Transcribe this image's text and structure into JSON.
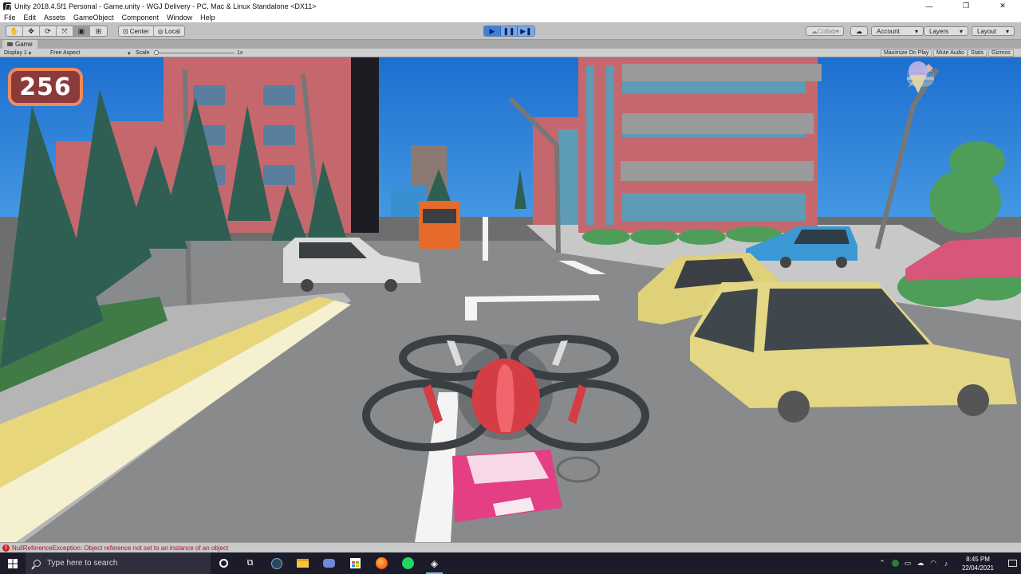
{
  "window": {
    "title": "Unity 2018.4.5f1 Personal - Game.unity - WGJ Delivery - PC, Mac & Linux Standalone <DX11>",
    "controls": [
      "—",
      "❐",
      "✕"
    ]
  },
  "menu": [
    "File",
    "Edit",
    "Assets",
    "GameObject",
    "Component",
    "Window",
    "Help"
  ],
  "toolbar": {
    "pivot": "Center",
    "space": "Local",
    "collab": "Collab",
    "account": "Account",
    "layers": "Layers",
    "layout": "Layout"
  },
  "game_tab": {
    "label": "Game",
    "display": "Display 1",
    "aspect": "Free Aspect",
    "scale_label": "Scale",
    "scale_value": "1x",
    "maximize": "Maximize On Play",
    "mute": "Mute Audio",
    "stats": "Stats",
    "gizmos": "Gizmos"
  },
  "hud": {
    "score": "256",
    "food_icons": [
      "burger-icon",
      "burger-icon",
      "burger-icon",
      "pizza-icon",
      "pizza-icon",
      "pizza-icon",
      "icecream-icon",
      "icecream-icon",
      "icecream-icon"
    ]
  },
  "console": {
    "message": "NullReferenceException: Object reference not set to an instance of an object"
  },
  "taskbar": {
    "search_placeholder": "Type here to search",
    "time": "8:45 PM",
    "date": "22/04/2021"
  },
  "colors": {
    "score_bg": "#8b3a3a",
    "score_border": "#f08a5d",
    "play_active": "#3f7fd8",
    "error": "#d42020"
  }
}
